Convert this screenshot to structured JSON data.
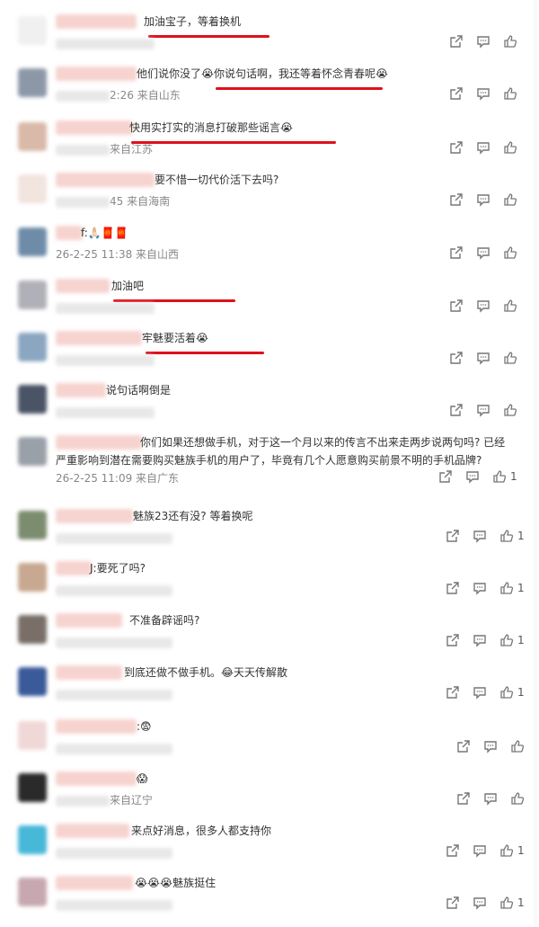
{
  "comments": [
    {
      "avatar_color": "#f0f0f0",
      "text": "加油宝子，等着换机",
      "meta": "",
      "likes": ""
    },
    {
      "avatar_color": "#8c98a8",
      "text": "他们说你没了😭你说句话啊，我还等着怀念青春呢😭",
      "meta": "2:26 来自山东",
      "likes": ""
    },
    {
      "avatar_color": "#d9b9a8",
      "text": "快用实打实的消息打破那些谣言😭",
      "meta": "来自江苏",
      "likes": ""
    },
    {
      "avatar_color": "#f2e4df",
      "text": "要不惜一切代价活下去吗?",
      "meta": "45 来自海南",
      "likes": ""
    },
    {
      "avatar_color": "#6e8ca8",
      "text": "f:🙏🏻🧧🧧",
      "meta": "26-2-25 11:38 来自山西",
      "likes": ""
    },
    {
      "avatar_color": "#b0b0b8",
      "text": "加油吧",
      "meta": "",
      "likes": ""
    },
    {
      "avatar_color": "#8aa6c0",
      "text": "牢魅要活着😭",
      "meta": "",
      "likes": ""
    },
    {
      "avatar_color": "#4a5466",
      "text": "说句话啊倒是",
      "meta": "",
      "likes": ""
    },
    {
      "avatar_color": "#9aa0a8",
      "text": "你们如果还想做手机，对于这一个月以来的传言不出来走两步说两句吗? 已经严重影响到潜在需要购买魅族手机的用户了，毕竟有几个人愿意购买前景不明的手机品牌?",
      "meta": "26-2-25 11:09 来自广东",
      "likes": "1"
    },
    {
      "avatar_color": "#7c8c6e",
      "text": "魅族23还有没? 等着换呢",
      "meta": "",
      "likes": "1"
    },
    {
      "avatar_color": "#c8a890",
      "text": "J:要死了吗?",
      "meta": "",
      "likes": "1"
    },
    {
      "avatar_color": "#7a6e68",
      "text": "不准备辟谣吗?",
      "meta": "",
      "likes": "1"
    },
    {
      "avatar_color": "#3a5a9a",
      "text": "到底还做不做手机。😂天天传解散",
      "meta": "",
      "likes": "1"
    },
    {
      "avatar_color": "#f0d8d8",
      "text": ":😨",
      "meta": "",
      "likes": ""
    },
    {
      "avatar_color": "#2a2a2a",
      "text": "😱",
      "meta": "来自辽宁",
      "likes": ""
    },
    {
      "avatar_color": "#48b8d8",
      "text": "来点好消息，很多人都支持你",
      "meta": "",
      "likes": "1"
    },
    {
      "avatar_color": "#c8a8b0",
      "text": "😭😭😭魅族挺住",
      "meta": "",
      "likes": "1"
    }
  ],
  "icons": {
    "share": "share-icon",
    "comment": "comment-icon",
    "like": "thumbs-up-icon"
  },
  "accent_underline": "#e0101c"
}
